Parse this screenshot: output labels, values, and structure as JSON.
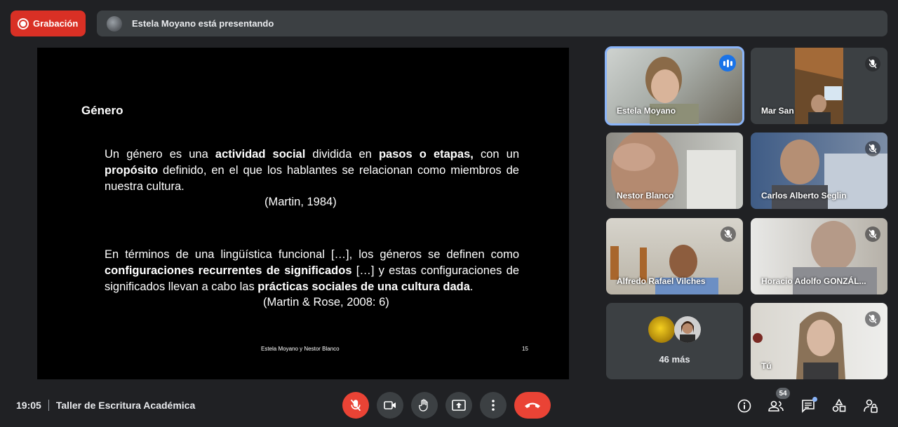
{
  "recording": {
    "label": "Grabación"
  },
  "presenting_banner": {
    "text": "Estela Moyano está presentando"
  },
  "slide": {
    "title": "Género",
    "para1_parts": [
      "Un género es una ",
      "actividad social",
      " dividida en ",
      "pasos o etapas,",
      " con un ",
      "propósito",
      " definido, en el que los hablantes se relacionan como miembros de nuestra cultura."
    ],
    "cite1": "(Martin, 1984)",
    "para2_parts": [
      "En términos de una lingüística funcional […], los géneros se definen como ",
      "configuraciones recurrentes de significados",
      " […] y estas configuraciones de significados llevan a cabo las ",
      "prácticas sociales de una cultura dada",
      "."
    ],
    "cite2": "(Martin & Rose, 2008: 6)",
    "footer_authors": "Estela Moyano y Nestor Blanco",
    "footer_page": "15"
  },
  "participants": [
    {
      "name": "Estela Moyano",
      "status": "speaking"
    },
    {
      "name": "Mar San",
      "status": "muted"
    },
    {
      "name": "Nestor Blanco",
      "status": "none"
    },
    {
      "name": "Carlos Alberto Seglin",
      "status": "muted"
    },
    {
      "name": "Alfredo Rafael Vilches",
      "status": "muted"
    },
    {
      "name": "Horacio Adolfo GONZÁL...",
      "status": "muted"
    },
    {
      "name": "46 más",
      "status": "none"
    },
    {
      "name": "Tú",
      "status": "muted"
    }
  ],
  "bottom_bar": {
    "time": "19:05",
    "meeting_title": "Taller de Escritura Académica",
    "people_count": "54"
  },
  "colors": {
    "accent": "#8ab4f8",
    "danger": "#ea4335",
    "speaking": "#1a73e8"
  }
}
